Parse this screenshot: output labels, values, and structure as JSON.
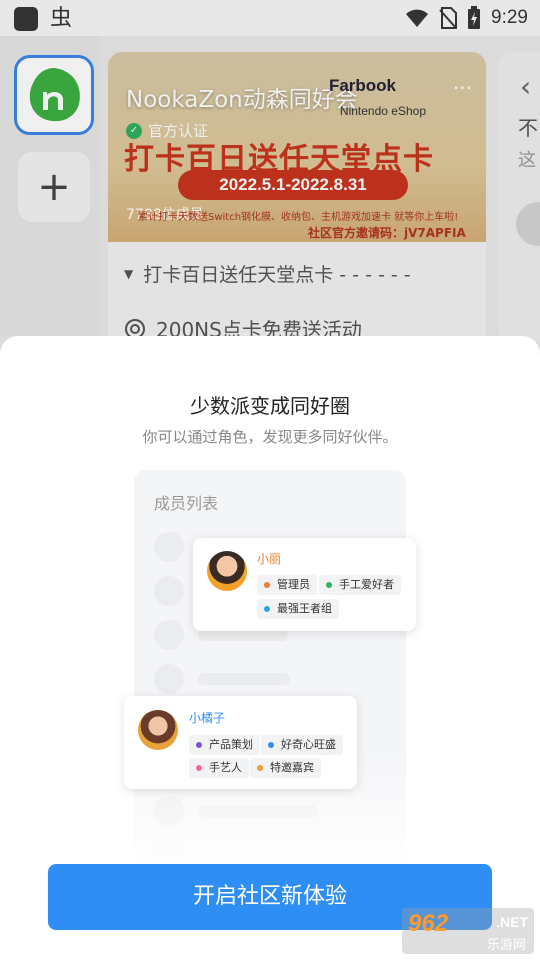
{
  "status_bar": {
    "app_char": "虫",
    "time": "9:29"
  },
  "background": {
    "banner_title": "NookaZon动森同好会",
    "banner_more": "···",
    "fb_logo": "Farbook",
    "nintendo_label": "Nintendo eShop",
    "verified_label": "官方认证",
    "promo_text": "打卡百日送任天堂点卡",
    "promo_dates": "2022.5.1-2022.8.31",
    "fine_print": "累计打卡天数送Switch钢化膜、收纳包、主机游戏加速卡 就等你上车啦!",
    "invite_code": "社区官方邀请码：jV7APFIA",
    "member_count": "7788位成员",
    "post_1": "打卡百日送任天堂点卡 - - - - - -",
    "post_2": "200NS点卡免费送活动",
    "right_card_text_1": "不",
    "right_card_text_2": "这"
  },
  "sheet": {
    "title": "少数派变成同好圈",
    "subtitle": "你可以通过角色，发现更多同好伙伴。",
    "list_title": "成员列表",
    "cta": "开启社区新体验",
    "members": [
      {
        "name": "小丽",
        "name_color": "#e8812a",
        "tags": [
          {
            "label": "管理员",
            "color": "#f07d2e"
          },
          {
            "label": "手工爱好者",
            "color": "#2bb55c"
          },
          {
            "label": "最强王者组",
            "color": "#24a8e0"
          }
        ]
      },
      {
        "name": "小橘子",
        "name_color": "#2f8ef3",
        "tags": [
          {
            "label": "产品策划",
            "color": "#7a52e0"
          },
          {
            "label": "好奇心旺盛",
            "color": "#2f8ef3"
          },
          {
            "label": "手艺人",
            "color": "#f06aa0"
          },
          {
            "label": "特邀嘉宾",
            "color": "#f29a2e"
          }
        ]
      }
    ]
  },
  "watermark": {
    "main": "962",
    "net": ".NET",
    "sub": "乐游网"
  }
}
